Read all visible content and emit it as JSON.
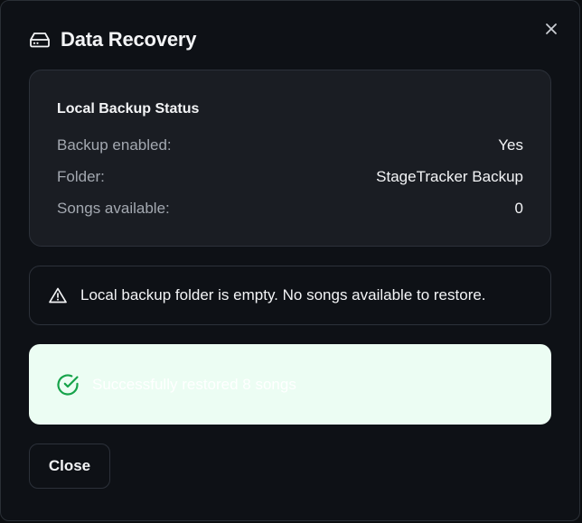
{
  "dialog": {
    "title": "Data Recovery",
    "title_icon": "hard-drive-icon",
    "close_icon": "close-icon"
  },
  "status": {
    "heading": "Local Backup Status",
    "rows": [
      {
        "label": "Backup enabled:",
        "value": "Yes"
      },
      {
        "label": "Folder:",
        "value": "StageTracker Backup"
      },
      {
        "label": "Songs available:",
        "value": "0"
      }
    ]
  },
  "alert": {
    "icon": "warning-icon",
    "text": "Local backup folder is empty. No songs available to restore."
  },
  "success": {
    "icon": "check-circle-icon",
    "text": "Successfully restored 8 songs",
    "background_color": "#ecfdf3",
    "accent_color": "#16a34a"
  },
  "footer": {
    "close_label": "Close"
  }
}
